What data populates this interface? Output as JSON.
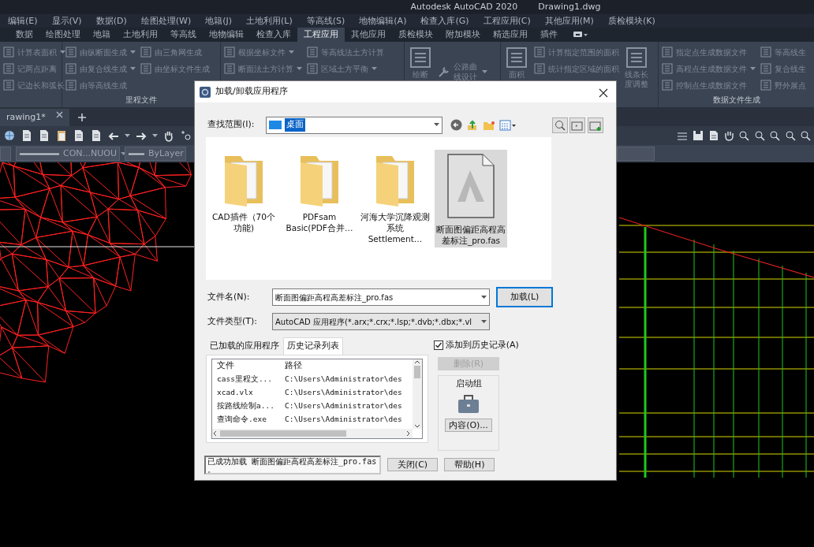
{
  "title_bar": {
    "app": "Autodesk AutoCAD 2020",
    "document": "Drawing1.dwg"
  },
  "menu_bar": [
    "编辑(E)",
    "显示(V)",
    "数据(D)",
    "绘图处理(W)",
    "地籍(J)",
    "土地利用(L)",
    "等高线(S)",
    "地物编辑(A)",
    "检查入库(G)",
    "工程应用(C)",
    "其他应用(M)",
    "质检模块(K)"
  ],
  "ribbon_tabs": [
    {
      "label": "数据",
      "selected": false
    },
    {
      "label": "绘图处理",
      "selected": false
    },
    {
      "label": "地籍",
      "selected": false
    },
    {
      "label": "土地利用",
      "selected": false
    },
    {
      "label": "等高线",
      "selected": false
    },
    {
      "label": "地物编辑",
      "selected": false
    },
    {
      "label": "检查入库",
      "selected": false
    },
    {
      "label": "工程应用",
      "selected": true
    },
    {
      "label": "其他应用",
      "selected": false
    },
    {
      "label": "质检模块",
      "selected": false
    },
    {
      "label": "附加模块",
      "selected": false
    },
    {
      "label": "精选应用",
      "selected": false
    },
    {
      "label": "插件",
      "selected": false
    }
  ],
  "ribbon_panels": [
    {
      "columns": [
        [
          {
            "kind": "small",
            "label": "计算表面积",
            "has_menu": true
          },
          {
            "kind": "small",
            "label": "记两点距离",
            "has_menu": false
          },
          {
            "kind": "small",
            "label": "记边长和弧长",
            "has_menu": false
          }
        ]
      ]
    },
    {
      "title": "里程文件",
      "columns": [
        [
          {
            "kind": "small",
            "label": "由纵断面生成",
            "has_menu": true
          },
          {
            "kind": "small",
            "label": "由复合线生成",
            "has_menu": true
          },
          {
            "kind": "small",
            "label": "由等高线生成",
            "has_menu": false
          }
        ],
        [
          {
            "kind": "small",
            "label": "由三角网生成",
            "has_menu": false
          },
          {
            "kind": "small",
            "label": "由坐标文件生成",
            "has_menu": false
          }
        ]
      ]
    },
    {
      "columns": [
        [
          {
            "kind": "small",
            "label": "根据坐标文件",
            "has_menu": true
          },
          {
            "kind": "small",
            "label": "断面法土方计算",
            "has_menu": true
          }
        ],
        [
          {
            "kind": "small",
            "label": "等高线法土方计算",
            "has_menu": false
          },
          {
            "kind": "small",
            "label": "区域土方平衡",
            "has_menu": true
          }
        ]
      ]
    },
    {
      "columns": [
        [
          {
            "kind": "large",
            "label": "绘断",
            "has_menu": false
          }
        ],
        [
          {
            "kind": "medium",
            "label": "公路曲线设计",
            "has_menu": true
          }
        ]
      ]
    },
    {
      "columns": [
        [
          {
            "kind": "large",
            "label": "面积",
            "has_menu": false
          }
        ],
        [
          {
            "kind": "small",
            "label": "计算指定范围的面积",
            "has_menu": false
          },
          {
            "kind": "small",
            "label": "统计指定区域的面积",
            "has_menu": false
          }
        ],
        [
          {
            "kind": "large",
            "label": "线条长度调整",
            "has_menu": false
          }
        ]
      ]
    },
    {
      "title": "数据文件生成",
      "columns": [
        [
          {
            "kind": "small",
            "label": "指定点生成数据文件",
            "has_menu": false
          },
          {
            "kind": "small",
            "label": "高程点生成数据文件",
            "has_menu": true
          },
          {
            "kind": "small",
            "label": "控制点生成数据文件",
            "has_menu": false
          }
        ],
        [
          {
            "kind": "small",
            "label": "等高线生",
            "has_menu": false
          },
          {
            "kind": "small",
            "label": "复合线生",
            "has_menu": false
          },
          {
            "kind": "small",
            "label": "野外展点",
            "has_menu": false
          }
        ]
      ]
    }
  ],
  "document_tab": {
    "label": "rawing1*"
  },
  "properties": {
    "linetype": "CON...NUOU",
    "lineweight": "ByLayer"
  },
  "dialog": {
    "title": "加载/卸载应用程序",
    "look_in": {
      "label": "查找范围(I):",
      "value": "桌面"
    },
    "files": [
      {
        "kind": "folder",
        "label": "CAD插件（70个功能)",
        "selected": false
      },
      {
        "kind": "folder",
        "label": "PDFsam Basic(PDF合并…",
        "selected": false
      },
      {
        "kind": "folder",
        "label": "河海大学沉降观测系统Settlement…",
        "selected": false
      },
      {
        "kind": "fas",
        "label": "断面图偏距高程高差标注_pro.fas",
        "selected": true
      }
    ],
    "file_name": {
      "label": "文件名(N):",
      "value": "断面图偏距高程高差标注_pro.fas"
    },
    "file_type": {
      "label": "文件类型(T):",
      "value": "AutoCAD 应用程序(*.arx;*.crx;*.lsp;*.dvb;*.dbx;*.vl"
    },
    "load_button": "加载(L)",
    "tabs": [
      {
        "label": "已加载的应用程序",
        "selected": false
      },
      {
        "label": "历史记录列表",
        "selected": true
      }
    ],
    "table": {
      "columns": [
        "文件",
        "路径"
      ],
      "rows": [
        [
          "cass里程文...",
          "C:\\Users\\Administrator\\des"
        ],
        [
          "xcad.vlx",
          "C:\\Users\\Administrator\\des"
        ],
        [
          "按路线绘制a...",
          "C:\\Users\\Administrator\\des"
        ],
        [
          "查询命令.exe",
          "C:\\Users\\Administrator\\des"
        ]
      ]
    },
    "add_to_history": {
      "label": "添加到历史记录(A)",
      "checked": true
    },
    "remove_button": {
      "label": "删除(R)",
      "disabled": true
    },
    "startup_group": {
      "title": "启动组",
      "button": "内容(O)..."
    },
    "status": "已成功加载 断面图偏距高程高差标注_pro.fas 。",
    "close_button": "关闭(C)",
    "help_button": "帮助(H)"
  }
}
